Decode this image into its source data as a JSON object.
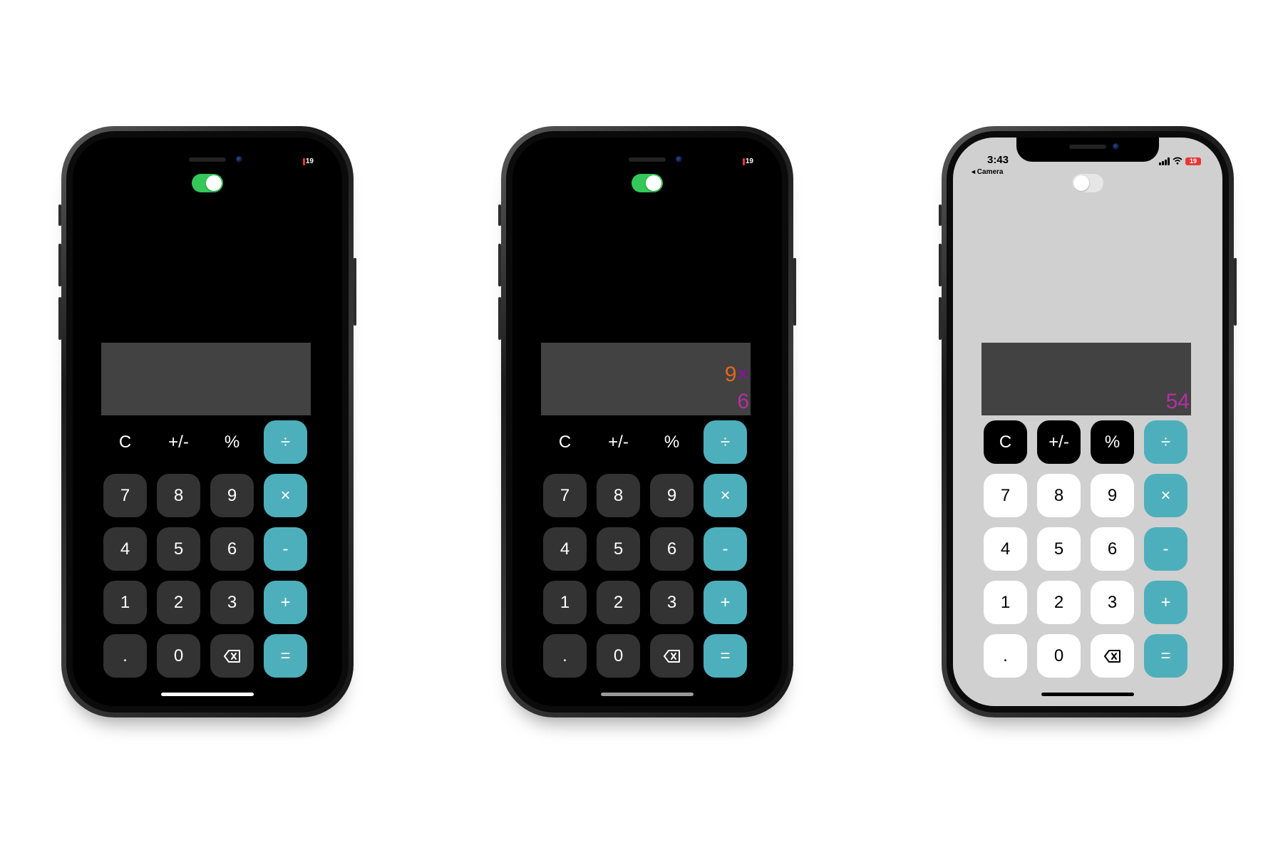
{
  "phones": [
    {
      "theme": "dark",
      "toggle_on": true,
      "battery": "19",
      "display": {
        "operand": "",
        "operator": "",
        "second": ""
      },
      "keys": {
        "fn": [
          "C",
          "+/-",
          "%"
        ],
        "ops": [
          "÷",
          "×",
          "-",
          "+",
          "="
        ],
        "rows": [
          [
            "7",
            "8",
            "9"
          ],
          [
            "4",
            "5",
            "6"
          ],
          [
            "1",
            "2",
            "3"
          ]
        ],
        "bottom": [
          ".",
          "0"
        ]
      }
    },
    {
      "theme": "dark",
      "toggle_on": true,
      "battery": "19",
      "display": {
        "operand": "9",
        "operator": "×",
        "second": "6"
      },
      "keys": {
        "fn": [
          "C",
          "+/-",
          "%"
        ],
        "ops": [
          "÷",
          "×",
          "-",
          "+",
          "="
        ],
        "rows": [
          [
            "7",
            "8",
            "9"
          ],
          [
            "4",
            "5",
            "6"
          ],
          [
            "1",
            "2",
            "3"
          ]
        ],
        "bottom": [
          ".",
          "0"
        ]
      }
    },
    {
      "theme": "light",
      "toggle_on": false,
      "status_time": "3:43",
      "status_back": "◂ Camera",
      "battery": "19",
      "display": {
        "operand": "",
        "operator": "",
        "second": "54"
      },
      "keys": {
        "fn": [
          "C",
          "+/-",
          "%"
        ],
        "ops": [
          "÷",
          "×",
          "-",
          "+",
          "="
        ],
        "rows": [
          [
            "7",
            "8",
            "9"
          ],
          [
            "4",
            "5",
            "6"
          ],
          [
            "1",
            "2",
            "3"
          ]
        ],
        "bottom": [
          ".",
          "0"
        ]
      }
    }
  ],
  "icons": {
    "backspace": "backspace-icon",
    "wifi": "wifi-icon",
    "signal": "signal-icon",
    "battery": "battery-icon"
  },
  "colors": {
    "operator_key": "#4eafbc",
    "display_bg": "#424242",
    "result_text": "#b52fa3",
    "operand_text": "#e06a1b",
    "operator_text": "#7a1d8a",
    "toggle_on": "#34c759"
  }
}
